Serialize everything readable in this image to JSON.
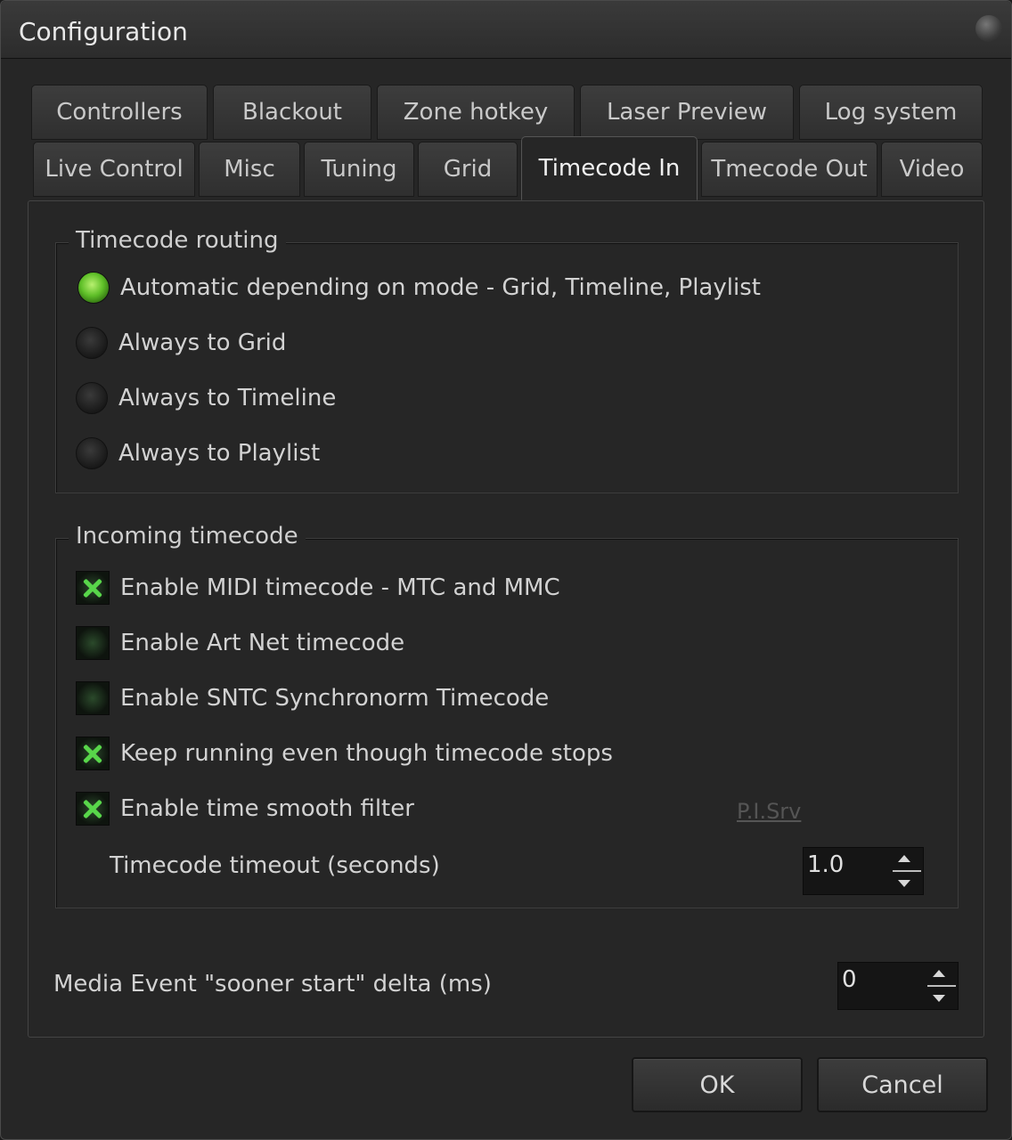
{
  "window": {
    "title": "Configuration"
  },
  "tabs": {
    "row1": [
      "Controllers",
      "Blackout",
      "Zone hotkey",
      "Laser Preview",
      "Log system"
    ],
    "row2": [
      "Live Control",
      "Misc",
      "Tuning",
      "Grid",
      "Timecode In",
      "Tmecode Out",
      "Video"
    ],
    "active": "Timecode In"
  },
  "routing": {
    "title": "Timecode routing",
    "options": [
      {
        "label": "Automatic depending on mode - Grid, Timeline, Playlist",
        "selected": true
      },
      {
        "label": "Always to Grid",
        "selected": false
      },
      {
        "label": "Always to Timeline",
        "selected": false
      },
      {
        "label": "Always to Playlist",
        "selected": false
      }
    ]
  },
  "incoming": {
    "title": "Incoming timecode",
    "checks": [
      {
        "label": "Enable MIDI timecode - MTC and MMC",
        "checked": true
      },
      {
        "label": "Enable Art Net timecode",
        "checked": false
      },
      {
        "label": "Enable SNTC Synchronorm Timecode",
        "checked": false
      },
      {
        "label": "Keep running even though timecode stops",
        "checked": true
      },
      {
        "label": "Enable time smooth filter",
        "checked": true
      }
    ],
    "link": "P.I.Srv",
    "timeout_label": "Timecode timeout (seconds)",
    "timeout_value": "1.0"
  },
  "media": {
    "label": "Media Event \"sooner start\" delta (ms)",
    "value": "0"
  },
  "buttons": {
    "ok": "OK",
    "cancel": "Cancel"
  },
  "colors": {
    "accent_green": "#5fbf28",
    "background": "#262626"
  }
}
